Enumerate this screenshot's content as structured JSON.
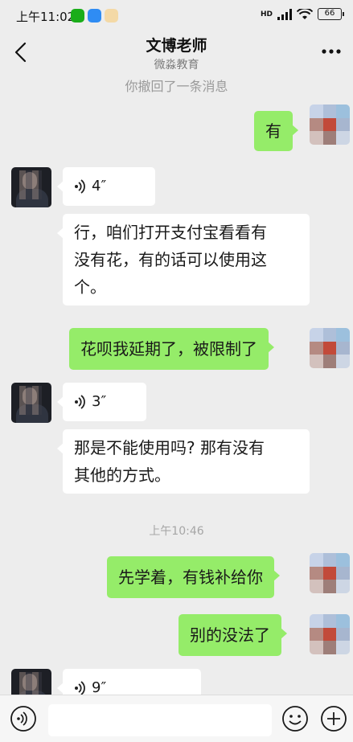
{
  "status_bar": {
    "time": "上午11:02",
    "network": "HD",
    "battery": "66"
  },
  "header": {
    "title": "文博老师",
    "subtitle": "微淼教育"
  },
  "chat": {
    "recall_notice": "你撤回了一条消息",
    "time_separator": "上午10:46",
    "messages": [
      {
        "side": "out",
        "type": "text",
        "text": "有"
      },
      {
        "side": "in",
        "type": "voice",
        "duration": "4″"
      },
      {
        "side": "in",
        "type": "text",
        "lines": [
          "行，咱们打开支付宝看看有",
          "没有花，有的话可以使用这",
          "个。"
        ]
      },
      {
        "side": "out",
        "type": "text",
        "text": "花呗我延期了，被限制了"
      },
      {
        "side": "in",
        "type": "voice",
        "duration": "3″"
      },
      {
        "side": "in",
        "type": "text",
        "lines": [
          "那是不能使用吗? 那有没有",
          "其他的方式。"
        ]
      },
      {
        "side": "out",
        "type": "text",
        "text": "先学着，有钱补给你"
      },
      {
        "side": "out",
        "type": "text",
        "text": "别的没法了"
      },
      {
        "side": "in",
        "type": "voice",
        "duration": "9″"
      }
    ]
  },
  "input_bar": {
    "value": "",
    "placeholder": ""
  },
  "colors": {
    "background": "#ededed",
    "outgoing_bubble": "#95ec69",
    "incoming_bubble": "#ffffff"
  }
}
